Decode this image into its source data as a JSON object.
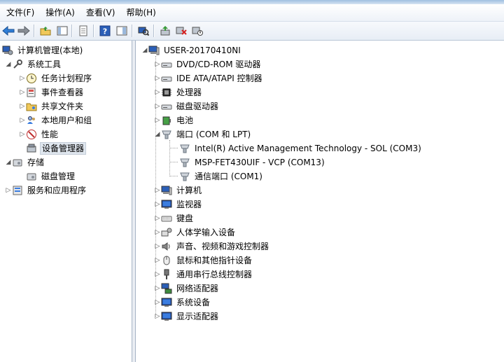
{
  "menu": [
    "文件(F)",
    "操作(A)",
    "查看(V)",
    "帮助(H)"
  ],
  "left_tree": {
    "root": "计算机管理(本地)",
    "system_tools": "系统工具",
    "task_scheduler": "任务计划程序",
    "event_viewer": "事件查看器",
    "shared_folders": "共享文件夹",
    "local_users": "本地用户和组",
    "performance": "性能",
    "device_manager": "设备管理器",
    "storage": "存储",
    "disk_management": "磁盘管理",
    "services_apps": "服务和应用程序"
  },
  "device_tree": {
    "computer": "USER-20170410NI",
    "categories": [
      "DVD/CD-ROM 驱动器",
      "IDE ATA/ATAPI 控制器",
      "处理器",
      "磁盘驱动器",
      "电池",
      "端口 (COM 和 LPT)",
      "计算机",
      "监视器",
      "键盘",
      "人体学输入设备",
      "声音、视频和游戏控制器",
      "鼠标和其他指针设备",
      "通用串行总线控制器",
      "网络适配器",
      "系统设备",
      "显示适配器"
    ],
    "ports": [
      "Intel(R) Active Management Technology - SOL (COM3)",
      "MSP-FET430UIF - VCP (COM13)",
      "通信端口 (COM1)"
    ]
  }
}
